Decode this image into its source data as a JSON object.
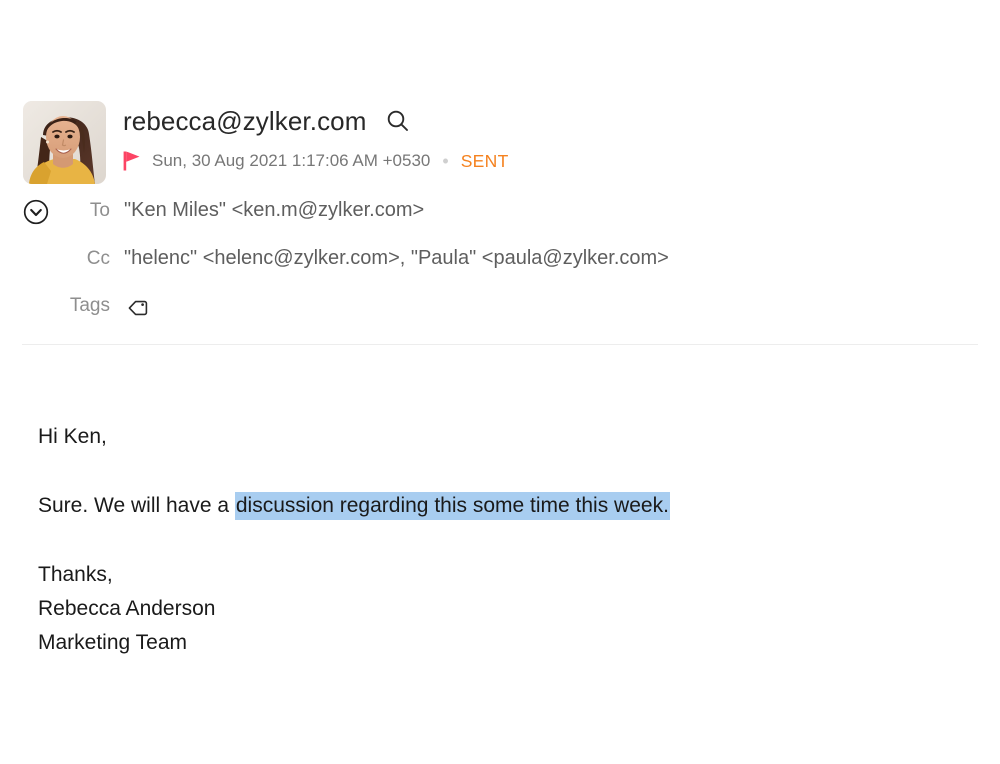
{
  "message": {
    "sender_email": "rebecca@zylker.com",
    "search_icon": "search-icon",
    "flag_icon": "flag-icon",
    "date": "Sun, 30 Aug 2021 1:17:06 AM +0530",
    "separator": "•",
    "status": "SENT",
    "expand_icon": "chevron-down-circle-icon",
    "fields": {
      "to_label": "To",
      "to_value": "\"Ken Miles\" <ken.m@zylker.com>",
      "cc_label": "Cc",
      "cc_value": "\"helenc\" <helenc@zylker.com>, \"Paula\" <paula@zylker.com>",
      "tags_label": "Tags",
      "tags_icon": "tag-icon"
    },
    "body": {
      "greeting": "Hi Ken,",
      "sentence_prefix": "Sure. We will have a ",
      "sentence_selected": "discussion regarding this some time this week.",
      "sign_off": "Thanks,",
      "sender_name": "Rebecca Anderson",
      "sender_team": "Marketing Team"
    },
    "avatar": "sender-avatar-photo"
  },
  "colors": {
    "status_orange": "#f5821f",
    "flag_pink": "#fc4464",
    "selection_blue": "#a8cdf0",
    "label_gray": "#8e8e8e",
    "value_gray": "#5e5e5e",
    "body_text": "#1a1a1a",
    "divider": "#ededed"
  }
}
